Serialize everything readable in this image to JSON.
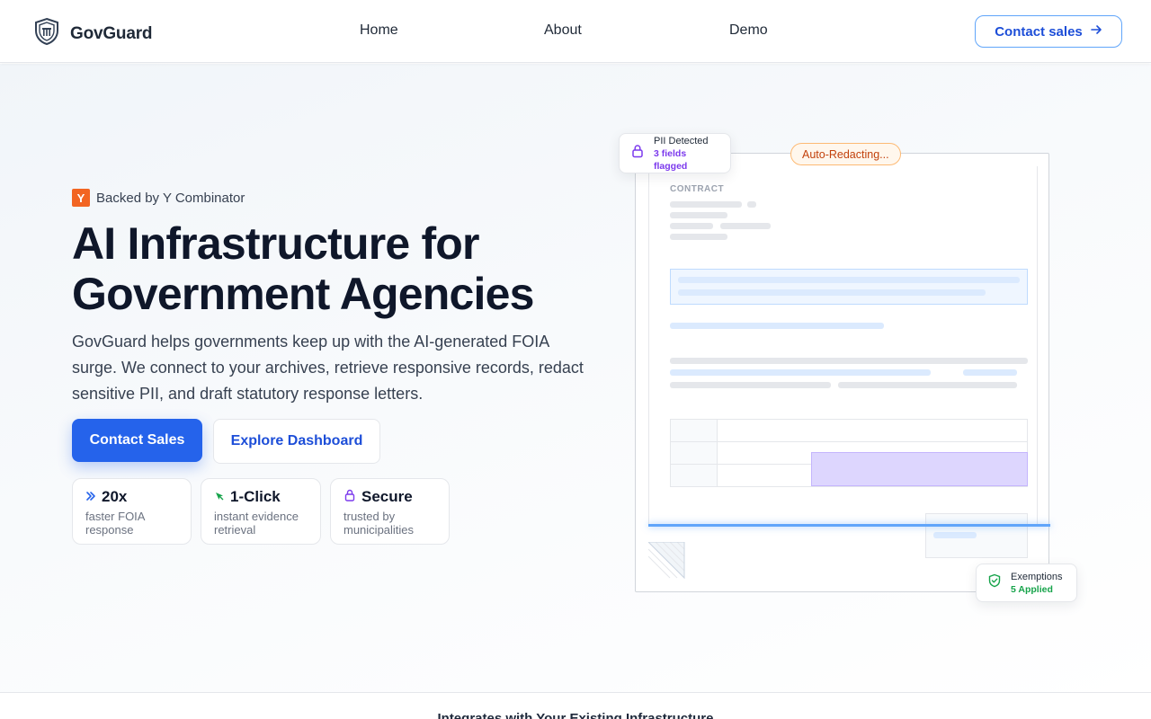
{
  "brand": {
    "name": "GovGuard"
  },
  "nav": {
    "items": [
      {
        "label": "Home"
      },
      {
        "label": "About"
      },
      {
        "label": "Demo"
      }
    ],
    "cta_label": "Contact sales"
  },
  "hero": {
    "badge_letter": "Y",
    "badge_text": "Backed by Y Combinator",
    "headline_line1": "AI Infrastructure for",
    "headline_line2": "Government Agencies",
    "description": "GovGuard helps governments keep up with the AI-generated FOIA surge. We connect to your archives, retrieve responsive records, redact sensitive PII, and draft statutory response letters.",
    "primary_cta": "Contact Sales",
    "secondary_cta": "Explore Dashboard",
    "stats": [
      {
        "value": "20x",
        "desc": "faster FOIA response",
        "icon": "double-chevron-right-icon"
      },
      {
        "value": "1-Click",
        "desc": "instant evidence retrieval",
        "icon": "cursor-icon"
      },
      {
        "value": "Secure",
        "desc": "trusted by municipalities",
        "icon": "lock-icon"
      }
    ]
  },
  "document_preview": {
    "label": "CONTRACT",
    "status_pill": "Auto-Redacting...",
    "pii_card": {
      "title": "PII Detected",
      "subtitle": "3 fields flagged"
    },
    "exemptions_card": {
      "title": "Exemptions",
      "subtitle": "5 Applied"
    }
  },
  "integrations": {
    "heading": "Integrates with Your Existing Infrastructure"
  },
  "colors": {
    "primary": "#2563eb",
    "yc_orange": "#f26522",
    "pii_purple": "#7c3aed",
    "exemption_green": "#16a34a",
    "redact_purple": "#ddd6fe"
  }
}
